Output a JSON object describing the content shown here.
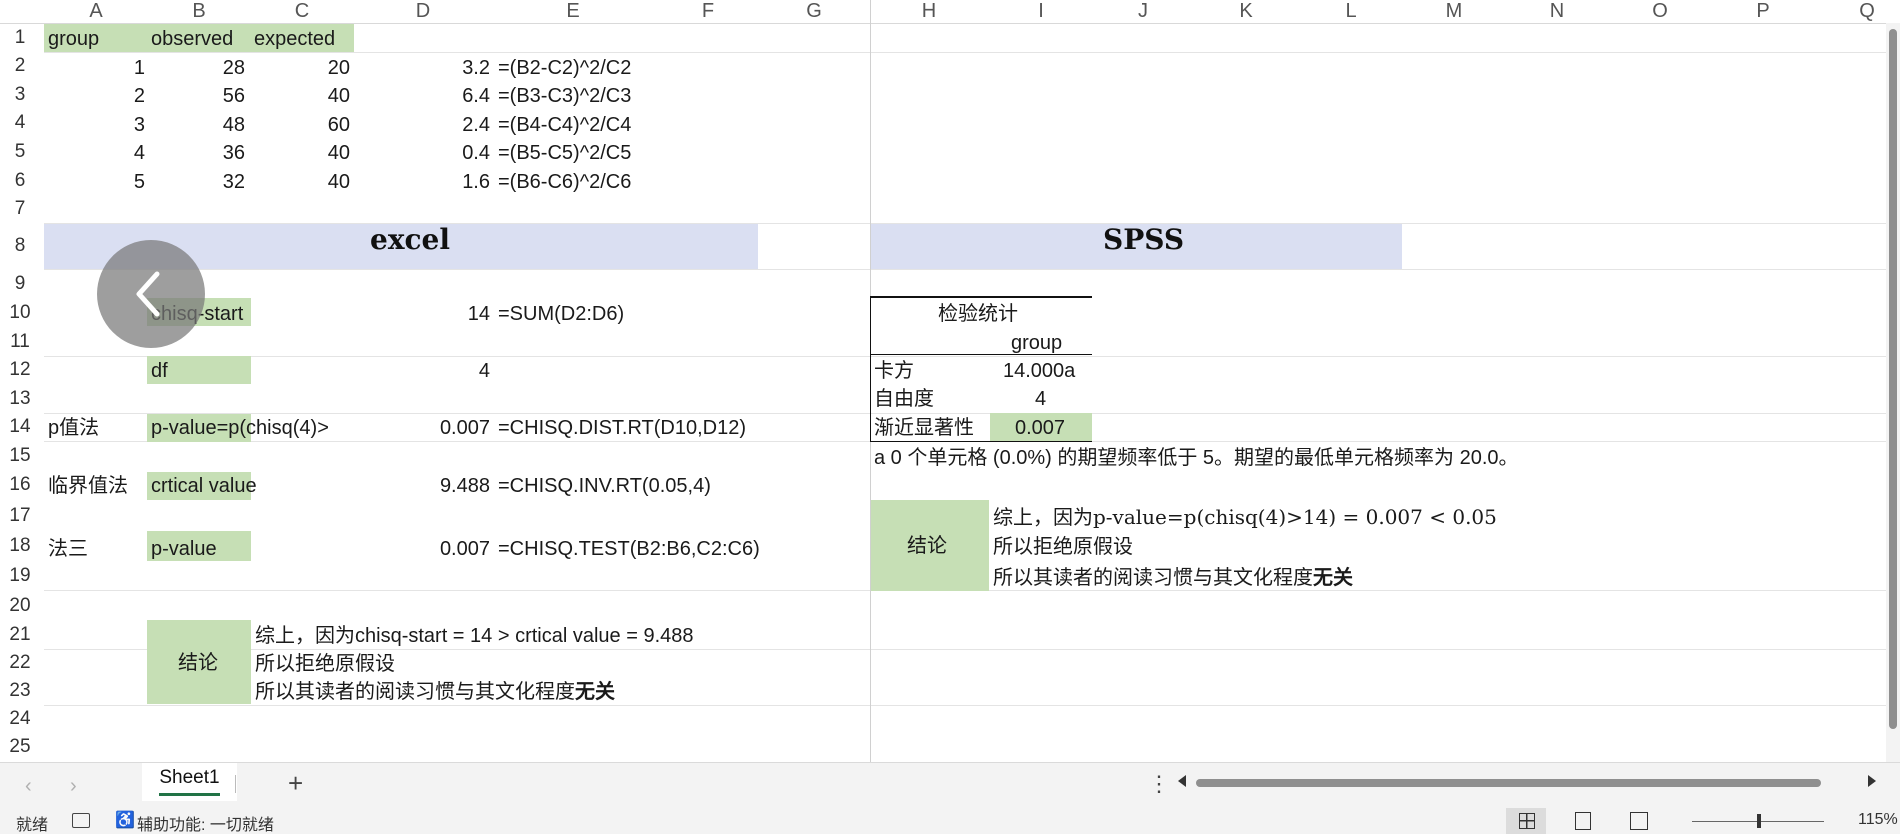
{
  "columns": [
    "A",
    "B",
    "C",
    "D",
    "E",
    "F",
    "G",
    "H",
    "I",
    "J",
    "K",
    "L",
    "M",
    "N",
    "O",
    "P",
    "Q"
  ],
  "rows": [
    "1",
    "2",
    "3",
    "4",
    "5",
    "6",
    "7",
    "8",
    "9",
    "10",
    "11",
    "12",
    "13",
    "14",
    "15",
    "16",
    "17",
    "18",
    "19",
    "20",
    "21",
    "22",
    "23",
    "24",
    "25"
  ],
  "table": {
    "headers": [
      "group",
      "observed",
      "expected"
    ],
    "data": [
      {
        "group": "1",
        "observed": "28",
        "expected": "20",
        "d": "3.2",
        "formula": "=(B2-C2)^2/C2"
      },
      {
        "group": "2",
        "observed": "56",
        "expected": "40",
        "d": "6.4",
        "formula": "=(B3-C3)^2/C3"
      },
      {
        "group": "3",
        "observed": "48",
        "expected": "60",
        "d": "2.4",
        "formula": "=(B4-C4)^2/C4"
      },
      {
        "group": "4",
        "observed": "36",
        "expected": "40",
        "d": "0.4",
        "formula": "=(B5-C5)^2/C5"
      },
      {
        "group": "5",
        "observed": "32",
        "expected": "40",
        "d": "1.6",
        "formula": "=(B6-C6)^2/C6"
      }
    ]
  },
  "excel": {
    "title": "excel",
    "chisq_label": "chisq-start",
    "chisq_value": "14",
    "chisq_formula": "=SUM(D2:D6)",
    "df_label": "df",
    "df_value": "4",
    "p_method": "p值法",
    "p_label": "p-value=p(chisq(4)>",
    "p_value": "0.007",
    "p_formula": "=CHISQ.DIST.RT(D10,D12)",
    "crit_method": "临界值法",
    "crit_label": "crtical value",
    "crit_value": "9.488",
    "crit_formula": "=CHISQ.INV.RT(0.05,4)",
    "m3_method": "法三",
    "m3_label": "p-value",
    "m3_value": "0.007",
    "m3_formula": "=CHISQ.TEST(B2:B6,C2:C6)",
    "conclusion_label": "结论",
    "conclusion_line1": "综上，因为chisq-start = 14 > crtical value = 9.488",
    "conclusion_line2": "所以拒绝原假设",
    "conclusion_line3_prefix": "所以其读者的阅读习惯与其文化程度",
    "conclusion_line3_bold": "无关"
  },
  "spss": {
    "title": "SPSS",
    "table_title": "检验统计",
    "col_header": "group",
    "row1_label": "卡方",
    "row1_value": "14.000a",
    "row2_label": "自由度",
    "row2_value": "4",
    "row3_label": "渐近显著性",
    "row3_value": "0.007",
    "footnote": "a 0 个单元格 (0.0%) 的期望频率低于 5。期望的最低单元格频率为 20.0。",
    "conclusion_label": "结论",
    "conclusion_line1": "综上，因为p-value=p(chisq(4)>14) = 0.007 < 0.05",
    "conclusion_line2": "所以拒绝原假设",
    "conclusion_line3_prefix": "所以其读者的阅读习惯与其文化程度",
    "conclusion_line3_bold": "无关"
  },
  "tabs": {
    "sheet1": "Sheet1",
    "add": "+"
  },
  "status": {
    "ready": "就绪",
    "accessibility": "辅助功能: 一切就绪",
    "zoom": "115%"
  },
  "colors": {
    "green_fill": "#c6dfb5",
    "blue_fill": "#dadff2"
  }
}
